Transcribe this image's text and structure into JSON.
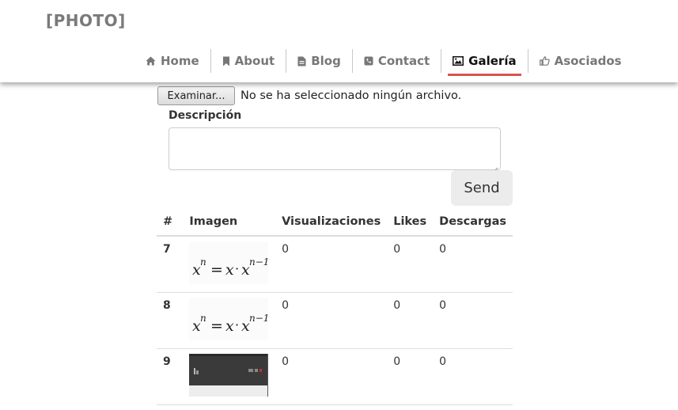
{
  "site": {
    "logo": "[PHOTO]"
  },
  "nav": {
    "items": [
      {
        "label": "Home",
        "icon": "home-icon"
      },
      {
        "label": "About",
        "icon": "bookmark-icon"
      },
      {
        "label": "Blog",
        "icon": "document-icon"
      },
      {
        "label": "Contact",
        "icon": "phone-icon"
      },
      {
        "label": "Galería",
        "icon": "image-icon",
        "active": true
      },
      {
        "label": "Asociados",
        "icon": "thumbs-up-icon"
      }
    ],
    "active_color": "#d9534f"
  },
  "upload": {
    "browse_label": "Examinar...",
    "status": "No se ha seleccionado ningún archivo.",
    "description_label": "Descripción",
    "description_value": "",
    "send_label": "Send"
  },
  "table": {
    "headers": [
      "#",
      "Imagen",
      "Visualizaciones",
      "Likes",
      "Descargas"
    ],
    "rows": [
      {
        "id": "7",
        "image": "formula-thumbnail",
        "views": "0",
        "likes": "0",
        "downloads": "0"
      },
      {
        "id": "8",
        "image": "formula-thumbnail",
        "views": "0",
        "likes": "0",
        "downloads": "0"
      },
      {
        "id": "9",
        "image": "screenshot-thumbnail",
        "views": "0",
        "likes": "0",
        "downloads": "0"
      }
    ]
  }
}
